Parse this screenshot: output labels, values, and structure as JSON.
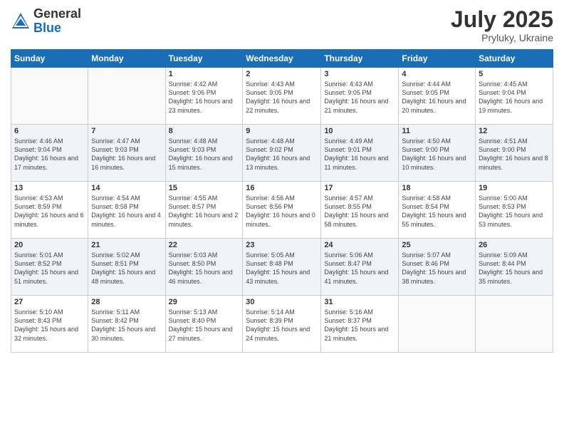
{
  "logo": {
    "general": "General",
    "blue": "Blue"
  },
  "title": {
    "month_year": "July 2025",
    "location": "Pryluky, Ukraine"
  },
  "weekdays": [
    "Sunday",
    "Monday",
    "Tuesday",
    "Wednesday",
    "Thursday",
    "Friday",
    "Saturday"
  ],
  "weeks": [
    [
      {
        "day": "",
        "sunrise": "",
        "sunset": "",
        "daylight": ""
      },
      {
        "day": "",
        "sunrise": "",
        "sunset": "",
        "daylight": ""
      },
      {
        "day": "1",
        "sunrise": "Sunrise: 4:42 AM",
        "sunset": "Sunset: 9:06 PM",
        "daylight": "Daylight: 16 hours and 23 minutes."
      },
      {
        "day": "2",
        "sunrise": "Sunrise: 4:43 AM",
        "sunset": "Sunset: 9:05 PM",
        "daylight": "Daylight: 16 hours and 22 minutes."
      },
      {
        "day": "3",
        "sunrise": "Sunrise: 4:43 AM",
        "sunset": "Sunset: 9:05 PM",
        "daylight": "Daylight: 16 hours and 21 minutes."
      },
      {
        "day": "4",
        "sunrise": "Sunrise: 4:44 AM",
        "sunset": "Sunset: 9:05 PM",
        "daylight": "Daylight: 16 hours and 20 minutes."
      },
      {
        "day": "5",
        "sunrise": "Sunrise: 4:45 AM",
        "sunset": "Sunset: 9:04 PM",
        "daylight": "Daylight: 16 hours and 19 minutes."
      }
    ],
    [
      {
        "day": "6",
        "sunrise": "Sunrise: 4:46 AM",
        "sunset": "Sunset: 9:04 PM",
        "daylight": "Daylight: 16 hours and 17 minutes."
      },
      {
        "day": "7",
        "sunrise": "Sunrise: 4:47 AM",
        "sunset": "Sunset: 9:03 PM",
        "daylight": "Daylight: 16 hours and 16 minutes."
      },
      {
        "day": "8",
        "sunrise": "Sunrise: 4:48 AM",
        "sunset": "Sunset: 9:03 PM",
        "daylight": "Daylight: 16 hours and 15 minutes."
      },
      {
        "day": "9",
        "sunrise": "Sunrise: 4:48 AM",
        "sunset": "Sunset: 9:02 PM",
        "daylight": "Daylight: 16 hours and 13 minutes."
      },
      {
        "day": "10",
        "sunrise": "Sunrise: 4:49 AM",
        "sunset": "Sunset: 9:01 PM",
        "daylight": "Daylight: 16 hours and 11 minutes."
      },
      {
        "day": "11",
        "sunrise": "Sunrise: 4:50 AM",
        "sunset": "Sunset: 9:00 PM",
        "daylight": "Daylight: 16 hours and 10 minutes."
      },
      {
        "day": "12",
        "sunrise": "Sunrise: 4:51 AM",
        "sunset": "Sunset: 9:00 PM",
        "daylight": "Daylight: 16 hours and 8 minutes."
      }
    ],
    [
      {
        "day": "13",
        "sunrise": "Sunrise: 4:53 AM",
        "sunset": "Sunset: 8:59 PM",
        "daylight": "Daylight: 16 hours and 6 minutes."
      },
      {
        "day": "14",
        "sunrise": "Sunrise: 4:54 AM",
        "sunset": "Sunset: 8:58 PM",
        "daylight": "Daylight: 16 hours and 4 minutes."
      },
      {
        "day": "15",
        "sunrise": "Sunrise: 4:55 AM",
        "sunset": "Sunset: 8:57 PM",
        "daylight": "Daylight: 16 hours and 2 minutes."
      },
      {
        "day": "16",
        "sunrise": "Sunrise: 4:56 AM",
        "sunset": "Sunset: 8:56 PM",
        "daylight": "Daylight: 16 hours and 0 minutes."
      },
      {
        "day": "17",
        "sunrise": "Sunrise: 4:57 AM",
        "sunset": "Sunset: 8:55 PM",
        "daylight": "Daylight: 15 hours and 58 minutes."
      },
      {
        "day": "18",
        "sunrise": "Sunrise: 4:58 AM",
        "sunset": "Sunset: 8:54 PM",
        "daylight": "Daylight: 15 hours and 55 minutes."
      },
      {
        "day": "19",
        "sunrise": "Sunrise: 5:00 AM",
        "sunset": "Sunset: 8:53 PM",
        "daylight": "Daylight: 15 hours and 53 minutes."
      }
    ],
    [
      {
        "day": "20",
        "sunrise": "Sunrise: 5:01 AM",
        "sunset": "Sunset: 8:52 PM",
        "daylight": "Daylight: 15 hours and 51 minutes."
      },
      {
        "day": "21",
        "sunrise": "Sunrise: 5:02 AM",
        "sunset": "Sunset: 8:51 PM",
        "daylight": "Daylight: 15 hours and 48 minutes."
      },
      {
        "day": "22",
        "sunrise": "Sunrise: 5:03 AM",
        "sunset": "Sunset: 8:50 PM",
        "daylight": "Daylight: 15 hours and 46 minutes."
      },
      {
        "day": "23",
        "sunrise": "Sunrise: 5:05 AM",
        "sunset": "Sunset: 8:48 PM",
        "daylight": "Daylight: 15 hours and 43 minutes."
      },
      {
        "day": "24",
        "sunrise": "Sunrise: 5:06 AM",
        "sunset": "Sunset: 8:47 PM",
        "daylight": "Daylight: 15 hours and 41 minutes."
      },
      {
        "day": "25",
        "sunrise": "Sunrise: 5:07 AM",
        "sunset": "Sunset: 8:46 PM",
        "daylight": "Daylight: 15 hours and 38 minutes."
      },
      {
        "day": "26",
        "sunrise": "Sunrise: 5:09 AM",
        "sunset": "Sunset: 8:44 PM",
        "daylight": "Daylight: 15 hours and 35 minutes."
      }
    ],
    [
      {
        "day": "27",
        "sunrise": "Sunrise: 5:10 AM",
        "sunset": "Sunset: 8:43 PM",
        "daylight": "Daylight: 15 hours and 32 minutes."
      },
      {
        "day": "28",
        "sunrise": "Sunrise: 5:11 AM",
        "sunset": "Sunset: 8:42 PM",
        "daylight": "Daylight: 15 hours and 30 minutes."
      },
      {
        "day": "29",
        "sunrise": "Sunrise: 5:13 AM",
        "sunset": "Sunset: 8:40 PM",
        "daylight": "Daylight: 15 hours and 27 minutes."
      },
      {
        "day": "30",
        "sunrise": "Sunrise: 5:14 AM",
        "sunset": "Sunset: 8:39 PM",
        "daylight": "Daylight: 15 hours and 24 minutes."
      },
      {
        "day": "31",
        "sunrise": "Sunrise: 5:16 AM",
        "sunset": "Sunset: 8:37 PM",
        "daylight": "Daylight: 15 hours and 21 minutes."
      },
      {
        "day": "",
        "sunrise": "",
        "sunset": "",
        "daylight": ""
      },
      {
        "day": "",
        "sunrise": "",
        "sunset": "",
        "daylight": ""
      }
    ]
  ]
}
